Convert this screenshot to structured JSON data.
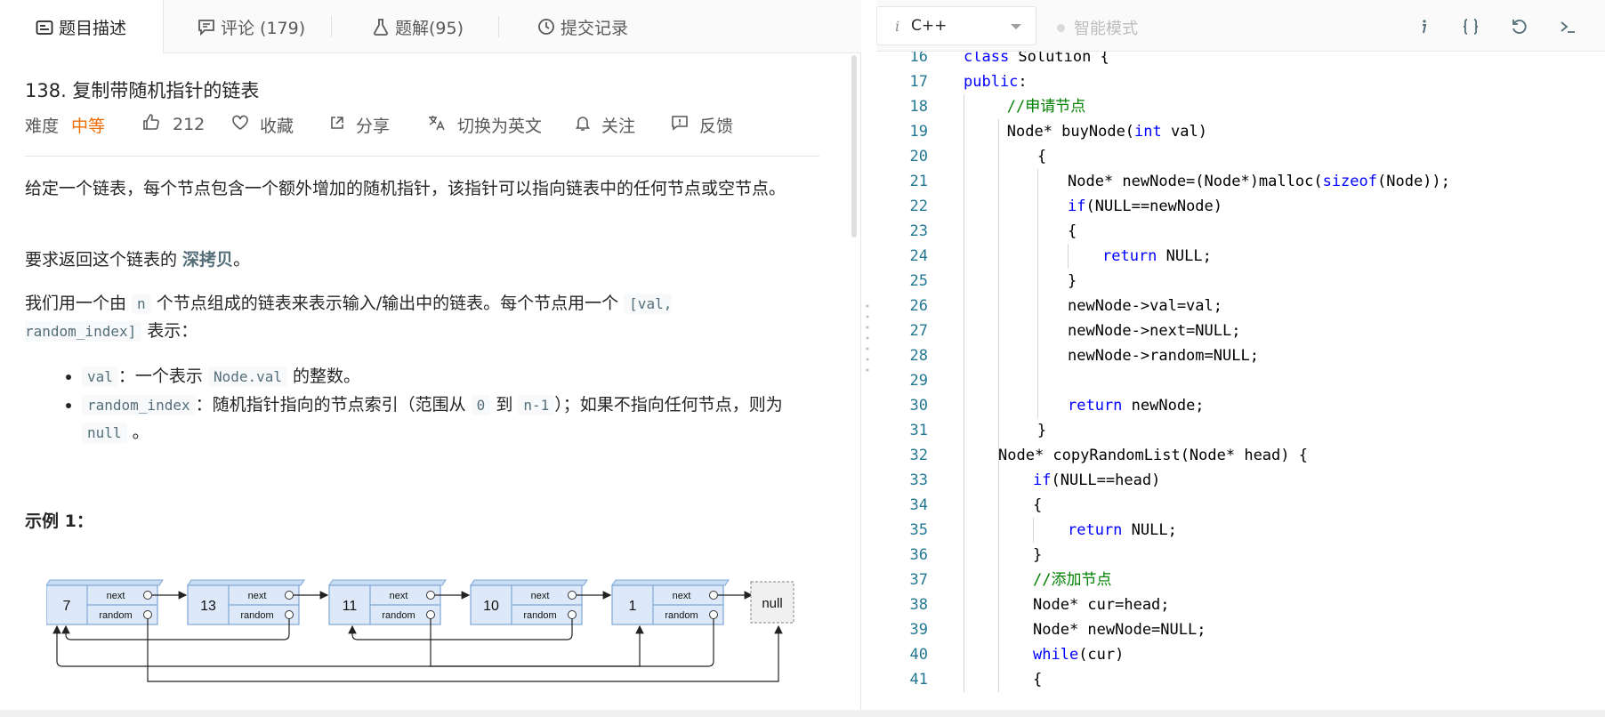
{
  "tabs": [
    {
      "label": "题目描述",
      "icon": "description-icon"
    },
    {
      "label": "评论 (179)",
      "icon": "comment-icon"
    },
    {
      "label": "题解(95)",
      "icon": "flask-icon"
    },
    {
      "label": "提交记录",
      "icon": "clock-icon"
    }
  ],
  "problem": {
    "title": "138. 复制带随机指针的链表",
    "difficulty_label": "难度",
    "difficulty": "中等",
    "likes": "212",
    "favorite": "收藏",
    "share": "分享",
    "switch_lang": "切换为英文",
    "follow": "关注",
    "feedback": "反馈",
    "desc1": "给定一个链表，每个节点包含一个额外增加的随机指针，该指针可以指向链表中的任何节点或空节点。",
    "desc2_pre": "要求返回这个链表的 ",
    "desc2_bold": "深拷贝",
    "desc2_post": "。",
    "desc3_a": "我们用一个由 ",
    "desc3_code_n": "n",
    "desc3_b": " 个节点组成的链表来表示输入/输出中的链表。每个节点用一个 ",
    "desc3_code_pair": "[val, random_index]",
    "desc3_c": " 表示：",
    "bullet1_code": "val",
    "bullet1_a": "：一个表示 ",
    "bullet1_code2": "Node.val",
    "bullet1_b": " 的整数。",
    "bullet2_code": "random_index",
    "bullet2_a": "：随机指针指向的节点索引（范围从 ",
    "bullet2_code_0": "0",
    "bullet2_b": " 到 ",
    "bullet2_code_n1": "n-1",
    "bullet2_c": "）；如果不指向任何节点，则为 ",
    "bullet2_code_null": "null",
    "bullet2_d": " 。",
    "example_title": "示例 1："
  },
  "diagram": {
    "nodes": [
      "7",
      "13",
      "11",
      "10",
      "1"
    ],
    "next_label": "next",
    "random_label": "random",
    "null_label": "null"
  },
  "editor": {
    "language": "C++",
    "lang_prefix": "i",
    "smart_mode": "智能模式",
    "lines": [
      {
        "n": "16",
        "code": "class Solution {"
      },
      {
        "n": "17",
        "code": "public:"
      },
      {
        "n": "18",
        "code": "//申请节点"
      },
      {
        "n": "19",
        "code": "Node* buyNode(int val)"
      },
      {
        "n": "20",
        "code": "{"
      },
      {
        "n": "21",
        "code": "Node* newNode=(Node*)malloc(sizeof(Node));"
      },
      {
        "n": "22",
        "code": "if(NULL==newNode)"
      },
      {
        "n": "23",
        "code": "{"
      },
      {
        "n": "24",
        "code": "return NULL;"
      },
      {
        "n": "25",
        "code": "}"
      },
      {
        "n": "26",
        "code": "newNode->val=val;"
      },
      {
        "n": "27",
        "code": "newNode->next=NULL;"
      },
      {
        "n": "28",
        "code": "newNode->random=NULL;"
      },
      {
        "n": "29",
        "code": ""
      },
      {
        "n": "30",
        "code": "return newNode;"
      },
      {
        "n": "31",
        "code": "}"
      },
      {
        "n": "32",
        "code": "Node* copyRandomList(Node* head) {"
      },
      {
        "n": "33",
        "code": "if(NULL==head)"
      },
      {
        "n": "34",
        "code": "{"
      },
      {
        "n": "35",
        "code": "return NULL;"
      },
      {
        "n": "36",
        "code": "}"
      },
      {
        "n": "37",
        "code": "//添加节点"
      },
      {
        "n": "38",
        "code": "Node* cur=head;"
      },
      {
        "n": "39",
        "code": "Node* newNode=NULL;"
      },
      {
        "n": "40",
        "code": "while(cur)"
      },
      {
        "n": "41",
        "code": "{"
      }
    ]
  },
  "colors": {
    "accent_orange": "#ef6c00",
    "keyword": "#0000ff",
    "comment": "#008000",
    "line_number": "#237893"
  }
}
